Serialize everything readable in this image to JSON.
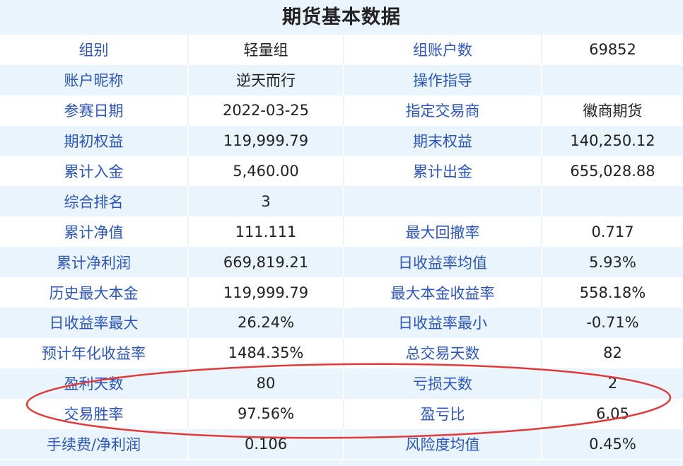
{
  "title": "期货基本数据",
  "rows": [
    {
      "l1": "组别",
      "v1": "轻量组",
      "l2": "组账户数",
      "v2": "69852"
    },
    {
      "l1": "账户昵称",
      "v1": "逆天而行",
      "l2": "操作指导",
      "v2": ""
    },
    {
      "l1": "参赛日期",
      "v1": "2022-03-25",
      "l2": "指定交易商",
      "v2": "徽商期货"
    },
    {
      "l1": "期初权益",
      "v1": "119,999.79",
      "l2": "期末权益",
      "v2": "140,250.12"
    },
    {
      "l1": "累计入金",
      "v1": "5,460.00",
      "l2": "累计出金",
      "v2": "655,028.88"
    },
    {
      "l1": "综合排名",
      "v1": "3",
      "l2": "",
      "v2": ""
    },
    {
      "l1": "累计净值",
      "v1": "111.111",
      "l2": "最大回撤率",
      "v2": "0.717"
    },
    {
      "l1": "累计净利润",
      "v1": "669,819.21",
      "l2": "日收益率均值",
      "v2": "5.93%"
    },
    {
      "l1": "历史最大本金",
      "v1": "119,999.79",
      "l2": "最大本金收益率",
      "v2": "558.18%"
    },
    {
      "l1": "日收益率最大",
      "v1": "26.24%",
      "l2": "日收益率最小",
      "v2": "-0.71%"
    },
    {
      "l1": "预计年化收益率",
      "v1": "1484.35%",
      "l2": "总交易天数",
      "v2": "82"
    },
    {
      "l1": "盈利天数",
      "v1": "80",
      "l2": "亏损天数",
      "v2": "2"
    },
    {
      "l1": "交易胜率",
      "v1": "97.56%",
      "l2": "盈亏比",
      "v2": "6.05"
    },
    {
      "l1": "手续费/净利润",
      "v1": "0.106",
      "l2": "风险度均值",
      "v2": "0.45%"
    }
  ],
  "colors": {
    "label": "#2b55c0",
    "value": "#222222",
    "stripe": "#e9f4fc",
    "annotation": "#e03a3a"
  }
}
